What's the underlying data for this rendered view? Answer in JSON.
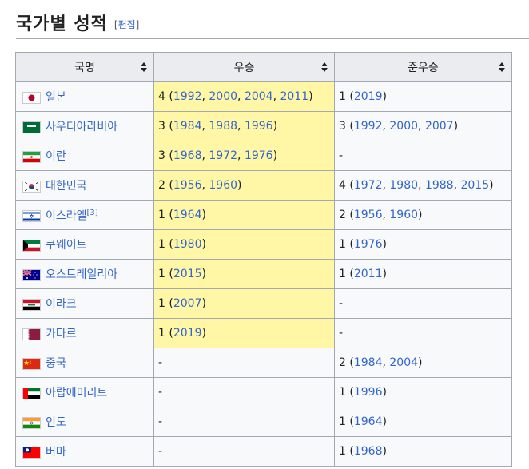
{
  "heading": {
    "title": "국가별 성적",
    "edit_open": "[",
    "edit_label": "편집",
    "edit_close": "]"
  },
  "columns": [
    "국명",
    "우승",
    "준우승"
  ],
  "rows": [
    {
      "flag": "japan-flag-icon",
      "country": "일본",
      "sup": "",
      "winners_count": "4",
      "winners_years": [
        "1992",
        "2000",
        "2004",
        "2011"
      ],
      "runners_count": "1",
      "runners_years": [
        "2019"
      ]
    },
    {
      "flag": "saudi-arabia-flag-icon",
      "country": "사우디아라비아",
      "sup": "",
      "winners_count": "3",
      "winners_years": [
        "1984",
        "1988",
        "1996"
      ],
      "runners_count": "3",
      "runners_years": [
        "1992",
        "2000",
        "2007"
      ]
    },
    {
      "flag": "iran-flag-icon",
      "country": "이란",
      "sup": "",
      "winners_count": "3",
      "winners_years": [
        "1968",
        "1972",
        "1976"
      ],
      "runners_count": "-",
      "runners_years": []
    },
    {
      "flag": "south-korea-flag-icon",
      "country": "대한민국",
      "sup": "",
      "winners_count": "2",
      "winners_years": [
        "1956",
        "1960"
      ],
      "runners_count": "4",
      "runners_years": [
        "1972",
        "1980",
        "1988",
        "2015"
      ]
    },
    {
      "flag": "israel-flag-icon",
      "country": "이스라엘",
      "sup": "[3]",
      "winners_count": "1",
      "winners_years": [
        "1964"
      ],
      "runners_count": "2",
      "runners_years": [
        "1956",
        "1960"
      ]
    },
    {
      "flag": "kuwait-flag-icon",
      "country": "쿠웨이트",
      "sup": "",
      "winners_count": "1",
      "winners_years": [
        "1980"
      ],
      "runners_count": "1",
      "runners_years": [
        "1976"
      ]
    },
    {
      "flag": "australia-flag-icon",
      "country": "오스트레일리아",
      "sup": "",
      "winners_count": "1",
      "winners_years": [
        "2015"
      ],
      "runners_count": "1",
      "runners_years": [
        "2011"
      ]
    },
    {
      "flag": "iraq-flag-icon",
      "country": "이라크",
      "sup": "",
      "winners_count": "1",
      "winners_years": [
        "2007"
      ],
      "runners_count": "-",
      "runners_years": []
    },
    {
      "flag": "qatar-flag-icon",
      "country": "카타르",
      "sup": "",
      "winners_count": "1",
      "winners_years": [
        "2019"
      ],
      "runners_count": "-",
      "runners_years": []
    },
    {
      "flag": "china-flag-icon",
      "country": "중국",
      "sup": "",
      "winners_count": "-",
      "winners_years": [],
      "runners_count": "2",
      "runners_years": [
        "1984",
        "2004"
      ]
    },
    {
      "flag": "uae-flag-icon",
      "country": "아랍에미리트",
      "sup": "",
      "winners_count": "-",
      "winners_years": [],
      "runners_count": "1",
      "runners_years": [
        "1996"
      ]
    },
    {
      "flag": "india-flag-icon",
      "country": "인도",
      "sup": "",
      "winners_count": "-",
      "winners_years": [],
      "runners_count": "1",
      "runners_years": [
        "1964"
      ]
    },
    {
      "flag": "burma-flag-icon",
      "country": "버마",
      "sup": "",
      "winners_count": "-",
      "winners_years": [],
      "runners_count": "1",
      "runners_years": [
        "1968"
      ]
    }
  ],
  "colors": {
    "winner_highlight": "#fff7a5",
    "link": "#3366cc",
    "header_bg": "#eaecf0",
    "cell_bg": "#f8f9fa"
  }
}
